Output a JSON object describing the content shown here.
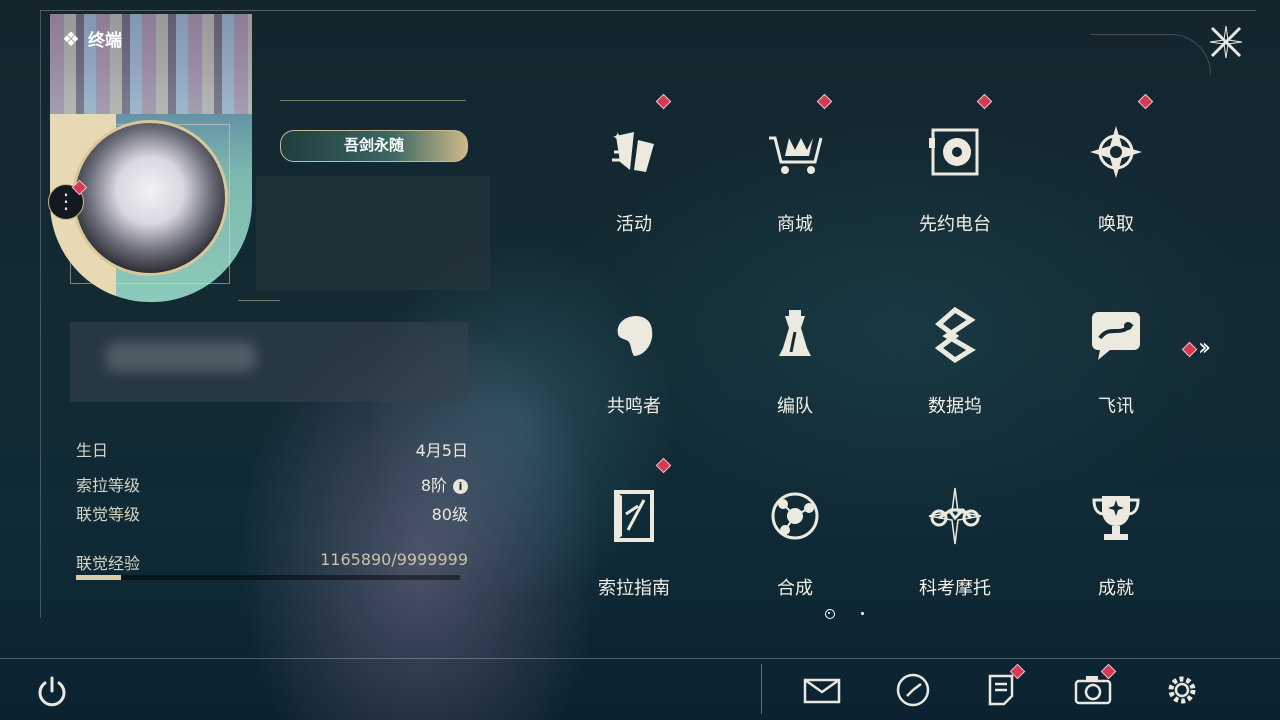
{
  "header": {
    "title": "终端"
  },
  "profile": {
    "title_badge": "吾剑永随",
    "info": [
      {
        "key": "生日",
        "value": "4月5日"
      },
      {
        "key": "索拉等级",
        "value": "8阶"
      },
      {
        "key": "联觉等级",
        "value": "80级"
      }
    ],
    "xp": {
      "label": "联觉经验",
      "value": "1165890/9999999",
      "current": 1165890,
      "max": 9999999
    }
  },
  "menu": {
    "items": [
      {
        "label": "活动",
        "icon": "activity-icon",
        "badge": true
      },
      {
        "label": "商城",
        "icon": "shop-cart-icon",
        "badge": true
      },
      {
        "label": "先约电台",
        "icon": "radio-icon",
        "badge": true
      },
      {
        "label": "唤取",
        "icon": "summon-icon",
        "badge": true
      },
      {
        "label": "共鸣者",
        "icon": "resonator-icon",
        "badge": false
      },
      {
        "label": "编队",
        "icon": "team-chess-icon",
        "badge": false
      },
      {
        "label": "数据坞",
        "icon": "data-dock-icon",
        "badge": false
      },
      {
        "label": "飞讯",
        "icon": "message-icon",
        "badge": false
      },
      {
        "label": "索拉指南",
        "icon": "guide-book-icon",
        "badge": true
      },
      {
        "label": "合成",
        "icon": "synthesis-icon",
        "badge": false
      },
      {
        "label": "科考摩托",
        "icon": "motorcycle-icon",
        "badge": false
      },
      {
        "label": "成就",
        "icon": "trophy-icon",
        "badge": false
      }
    ],
    "next_page_icon": "double-chevron-right-icon",
    "pages": 2,
    "current_page": 1
  },
  "bottom_bar": [
    {
      "icon": "mail-icon",
      "badge": false
    },
    {
      "icon": "clock-icon",
      "badge": false
    },
    {
      "icon": "notes-icon",
      "badge": true
    },
    {
      "icon": "camera-icon",
      "badge": true
    },
    {
      "icon": "settings-gear-icon",
      "badge": false
    }
  ],
  "colors": {
    "accent": "#d9cca4",
    "badge": "#d23b52",
    "background": "#13262e"
  }
}
